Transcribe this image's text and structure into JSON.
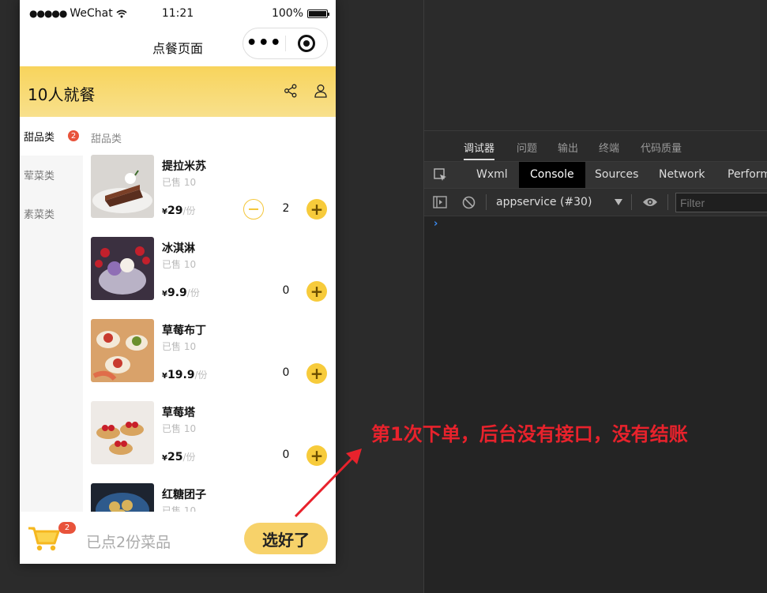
{
  "status_bar": {
    "carrier": "WeChat",
    "time": "11:21",
    "battery": "100%",
    "battery_level": 1.0
  },
  "nav": {
    "title": "点餐页面"
  },
  "banner": {
    "people_text": "10人就餐"
  },
  "categories": [
    {
      "label": "甜品类",
      "badge": "2",
      "active": true
    },
    {
      "label": "荤菜类"
    },
    {
      "label": "素菜类"
    }
  ],
  "section_title": "甜品类",
  "dishes": [
    {
      "name": "提拉米苏",
      "sold": "已售 10",
      "currency": "¥",
      "price": "29",
      "unit": "/份",
      "qty": "2"
    },
    {
      "name": "冰淇淋",
      "sold": "已售 10",
      "currency": "¥",
      "price": "9.9",
      "unit": "/份",
      "qty": "0"
    },
    {
      "name": "草莓布丁",
      "sold": "已售 10",
      "currency": "¥",
      "price": "19.9",
      "unit": "/份",
      "qty": "0"
    },
    {
      "name": "草莓塔",
      "sold": "已售 10",
      "currency": "¥",
      "price": "25",
      "unit": "/份",
      "qty": "0"
    },
    {
      "name": "红糖团子",
      "sold": "已售 10"
    }
  ],
  "cart": {
    "badge": "2",
    "summary": "已点2份菜品",
    "checkout_label": "选好了"
  },
  "devtools": {
    "top_tabs": [
      "调试器",
      "问题",
      "输出",
      "终端",
      "代码质量"
    ],
    "panels": [
      "Wxml",
      "Console",
      "Sources",
      "Network",
      "Perform"
    ],
    "active_panel": "Console",
    "context": "appservice (#30)",
    "filter_placeholder": "Filter",
    "prompt": "›"
  },
  "annotation": {
    "text": "第1次下单，后台没有接口，没有结账"
  },
  "colors": {
    "accent": "#f7cb3b",
    "badge": "#e8533b",
    "annotation": "#e8222c",
    "console_prompt": "#3b8bf2"
  }
}
